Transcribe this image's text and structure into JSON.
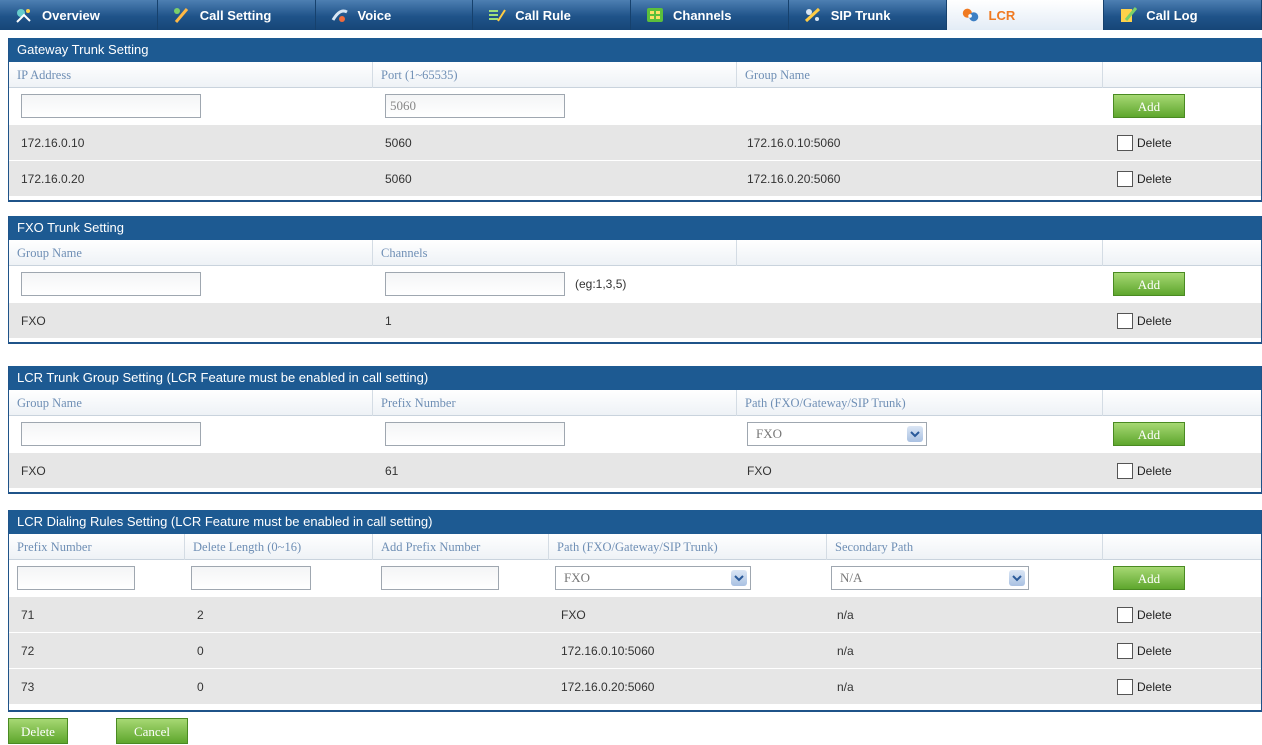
{
  "nav": {
    "tabs": [
      {
        "label": "Overview",
        "icon": "overview-icon"
      },
      {
        "label": "Call Setting",
        "icon": "call-setting-icon"
      },
      {
        "label": "Voice",
        "icon": "voice-icon"
      },
      {
        "label": "Call Rule",
        "icon": "call-rule-icon"
      },
      {
        "label": "Channels",
        "icon": "channels-icon"
      },
      {
        "label": "SIP Trunk",
        "icon": "sip-trunk-icon"
      },
      {
        "label": "LCR",
        "icon": "lcr-icon",
        "active": true
      },
      {
        "label": "Call Log",
        "icon": "call-log-icon"
      }
    ],
    "active_color": "#f07a22"
  },
  "gateway": {
    "title": "Gateway Trunk Setting",
    "headers": [
      "IP Address",
      "Port (1~65535)",
      "Group Name",
      ""
    ],
    "new_row": {
      "ip": "",
      "port": "5060"
    },
    "add_label": "Add",
    "rows": [
      {
        "ip": "172.16.0.10",
        "port": "5060",
        "group": "172.16.0.10:5060",
        "delete": "Delete"
      },
      {
        "ip": "172.16.0.20",
        "port": "5060",
        "group": "172.16.0.20:5060",
        "delete": "Delete"
      }
    ]
  },
  "fxo": {
    "title": "FXO Trunk Setting",
    "headers": [
      "Group Name",
      "Channels",
      "",
      ""
    ],
    "new_row": {
      "group": "",
      "channels": "",
      "hint": "(eg:1,3,5)"
    },
    "add_label": "Add",
    "rows": [
      {
        "group": "FXO",
        "channels": "1",
        "delete": "Delete"
      }
    ]
  },
  "lcr_group": {
    "title": "LCR Trunk Group Setting  (LCR Feature must be enabled in call setting)",
    "headers": [
      "Group Name",
      "Prefix Number",
      "Path (FXO/Gateway/SIP Trunk)",
      ""
    ],
    "new_row": {
      "group": "",
      "prefix": "",
      "path": "FXO"
    },
    "add_label": "Add",
    "rows": [
      {
        "group": "FXO",
        "prefix": "61",
        "path": "FXO",
        "delete": "Delete"
      }
    ]
  },
  "lcr_rules": {
    "title": "LCR Dialing Rules Setting  (LCR Feature must be enabled in call setting)",
    "headers": [
      "Prefix Number",
      "Delete Length (0~16)",
      "Add Prefix Number",
      "Path (FXO/Gateway/SIP Trunk)",
      "Secondary Path",
      ""
    ],
    "new_row": {
      "prefix": "",
      "delete_length": "",
      "add_prefix": "",
      "path": "FXO",
      "secondary": "N/A"
    },
    "add_label": "Add",
    "rows": [
      {
        "prefix": "71",
        "delete_length": "2",
        "path": "FXO",
        "secondary": "n/a",
        "delete": "Delete"
      },
      {
        "prefix": "72",
        "delete_length": "0",
        "path": "172.16.0.10:5060",
        "secondary": "n/a",
        "delete": "Delete"
      },
      {
        "prefix": "73",
        "delete_length": "0",
        "path": "172.16.0.20:5060",
        "secondary": "n/a",
        "delete": "Delete"
      }
    ]
  },
  "footer": {
    "delete_label": "Delete",
    "cancel_label": "Cancel"
  }
}
